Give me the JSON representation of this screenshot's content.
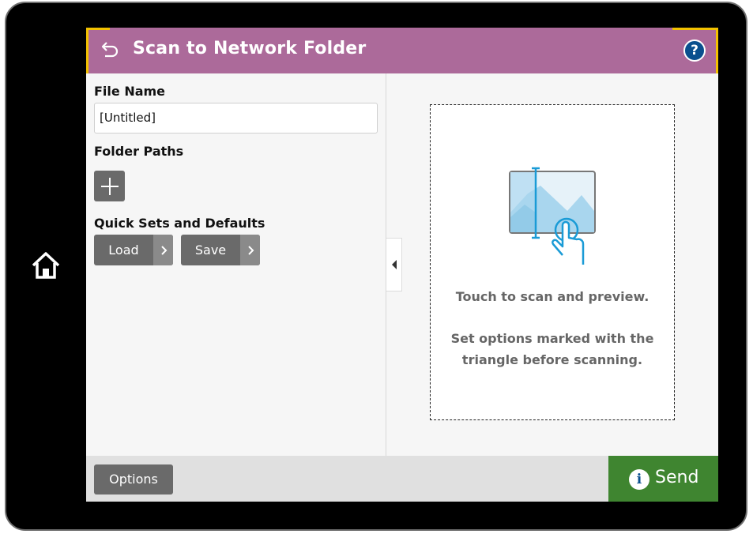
{
  "header": {
    "title": "Scan to Network Folder",
    "help_glyph": "?"
  },
  "file_name": {
    "label": "File Name",
    "value": "[Untitled]"
  },
  "folder_paths": {
    "label": "Folder Paths"
  },
  "quick_sets": {
    "label": "Quick Sets and Defaults",
    "load_label": "Load",
    "save_label": "Save"
  },
  "preview": {
    "line1": "Touch to scan and preview.",
    "line2": "Set options marked with the",
    "line3": "triangle before scanning."
  },
  "footer": {
    "options_label": "Options",
    "send_label": "Send",
    "send_icon_glyph": "i"
  },
  "icons": {
    "home": "home-icon",
    "back": "back-arrow-icon",
    "help": "help-icon",
    "add": "plus-icon",
    "chevron": "chevron-right-icon",
    "collapse": "triangle-left-icon",
    "preview": "scan-preview-icon",
    "info": "info-icon"
  },
  "colors": {
    "header": "#ac6a9a",
    "accent_corner": "#f2c100",
    "send": "#3f8530",
    "button_gray": "#6a6a6a",
    "help_blue": "#0a4f8e"
  }
}
